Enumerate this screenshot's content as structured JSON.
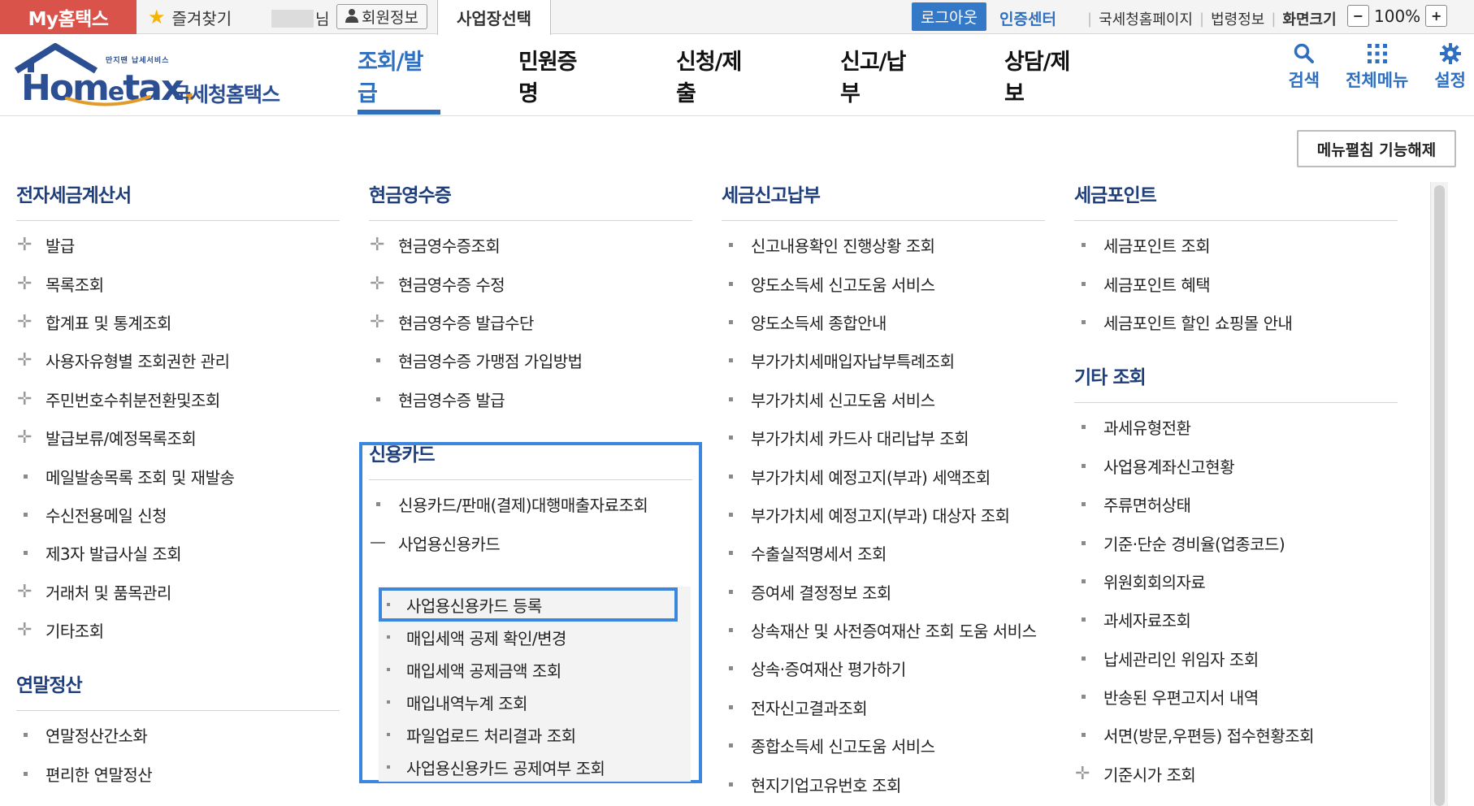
{
  "topbar": {
    "myhome": "My홈택스",
    "favorites": "즐겨찾기",
    "nim": "님",
    "member_info": "회원정보",
    "biz_select": "사업장선택",
    "logout": "로그아웃",
    "cert_center": "인증센터",
    "links": [
      "국세청홈페이지",
      "법령정보",
      "화면크기"
    ],
    "zoom_minus": "−",
    "zoom_value": "100%",
    "zoom_plus": "+"
  },
  "header": {
    "logo_small": "만지땐 납세서비스",
    "logo_word_a": "Hom",
    "logo_word_e": "e",
    "logo_word_b": "tax",
    "logo_dot": ".",
    "logo_kr": "국세청홈택스",
    "gnb": [
      "조회/발급",
      "민원증명",
      "신청/제출",
      "신고/납부",
      "상담/제보"
    ],
    "active_gnb": 0,
    "icons": {
      "search": "검색",
      "allmenu": "전체메뉴",
      "settings": "설정"
    }
  },
  "fold_button": "메뉴펼침 기능해제",
  "columns": {
    "c1": {
      "title": "전자세금계산서",
      "items": [
        {
          "label": "발급",
          "icon": "plus"
        },
        {
          "label": "목록조회",
          "icon": "plus"
        },
        {
          "label": "합계표 및 통계조회",
          "icon": "plus"
        },
        {
          "label": "사용자유형별 조회권한 관리",
          "icon": "plus"
        },
        {
          "label": "주민번호수취분전환및조회",
          "icon": "plus"
        },
        {
          "label": "발급보류/예정목록조회",
          "icon": "plus"
        },
        {
          "label": "메일발송목록 조회 및 재발송",
          "icon": "bullet"
        },
        {
          "label": "수신전용메일 신청",
          "icon": "bullet"
        },
        {
          "label": "제3자 발급사실 조회",
          "icon": "bullet"
        },
        {
          "label": "거래처 및 품목관리",
          "icon": "plus"
        },
        {
          "label": "기타조회",
          "icon": "plus"
        }
      ],
      "title2": "연말정산",
      "items2": [
        {
          "label": "연말정산간소화",
          "icon": "bullet"
        },
        {
          "label": "편리한 연말정산",
          "icon": "bullet"
        }
      ]
    },
    "c2": {
      "title": "현금영수증",
      "items": [
        {
          "label": "현금영수증조회",
          "icon": "plus"
        },
        {
          "label": "현금영수증 수정",
          "icon": "plus"
        },
        {
          "label": "현금영수증 발급수단",
          "icon": "plus"
        },
        {
          "label": "현금영수증 가맹점 가입방법",
          "icon": "bullet"
        },
        {
          "label": "현금영수증 발급",
          "icon": "bullet"
        }
      ],
      "title2": "신용카드",
      "items2": [
        {
          "label": "신용카드/판매(결제)대행매출자료조회",
          "icon": "bullet"
        },
        {
          "label": "사업용신용카드",
          "icon": "minus"
        }
      ],
      "submenu": [
        "사업용신용카드 등록",
        "매입세액 공제 확인/변경",
        "매입세액 공제금액 조회",
        "매입내역누계 조회",
        "파일업로드 처리결과 조회",
        "사업용신용카드 공제여부 조회"
      ]
    },
    "c3": {
      "title": "세금신고납부",
      "items": [
        {
          "label": "신고내용확인 진행상황 조회",
          "icon": "bullet"
        },
        {
          "label": "양도소득세 신고도움 서비스",
          "icon": "bullet"
        },
        {
          "label": "양도소득세 종합안내",
          "icon": "bullet"
        },
        {
          "label": "부가가치세매입자납부특례조회",
          "icon": "bullet"
        },
        {
          "label": "부가가치세 신고도움 서비스",
          "icon": "bullet"
        },
        {
          "label": "부가가치세 카드사 대리납부 조회",
          "icon": "bullet"
        },
        {
          "label": "부가가치세 예정고지(부과) 세액조회",
          "icon": "bullet"
        },
        {
          "label": "부가가치세 예정고지(부과) 대상자 조회",
          "icon": "bullet"
        },
        {
          "label": "수출실적명세서 조회",
          "icon": "bullet"
        },
        {
          "label": "증여세 결정정보 조회",
          "icon": "bullet"
        },
        {
          "label": "상속재산 및 사전증여재산 조회 도움 서비스",
          "icon": "bullet"
        },
        {
          "label": "상속·증여재산 평가하기",
          "icon": "bullet"
        },
        {
          "label": "전자신고결과조회",
          "icon": "bullet"
        },
        {
          "label": "종합소득세 신고도움 서비스",
          "icon": "bullet"
        },
        {
          "label": "현지기업고유번호 조회",
          "icon": "bullet"
        }
      ]
    },
    "c4": {
      "title": "세금포인트",
      "items": [
        {
          "label": "세금포인트 조회",
          "icon": "bullet"
        },
        {
          "label": "세금포인트 혜택",
          "icon": "bullet"
        },
        {
          "label": "세금포인트 할인 쇼핑몰 안내",
          "icon": "bullet"
        }
      ],
      "title2": "기타 조회",
      "items2": [
        {
          "label": "과세유형전환",
          "icon": "bullet"
        },
        {
          "label": "사업용계좌신고현황",
          "icon": "bullet"
        },
        {
          "label": "주류면허상태",
          "icon": "bullet"
        },
        {
          "label": "기준·단순 경비율(업종코드)",
          "icon": "bullet"
        },
        {
          "label": "위원회회의자료",
          "icon": "bullet"
        },
        {
          "label": "과세자료조회",
          "icon": "bullet"
        },
        {
          "label": "납세관리인 위임자 조회",
          "icon": "bullet"
        },
        {
          "label": "반송된 우편고지서 내역",
          "icon": "bullet"
        },
        {
          "label": "서면(방문,우편등) 접수현황조회",
          "icon": "bullet"
        },
        {
          "label": "기준시가 조회",
          "icon": "plus"
        }
      ]
    }
  },
  "colors": {
    "accent": "#2f6fc0",
    "myhome_red": "#d9534a",
    "highlight": "#3d86dd",
    "heading": "#1f3e7c"
  }
}
